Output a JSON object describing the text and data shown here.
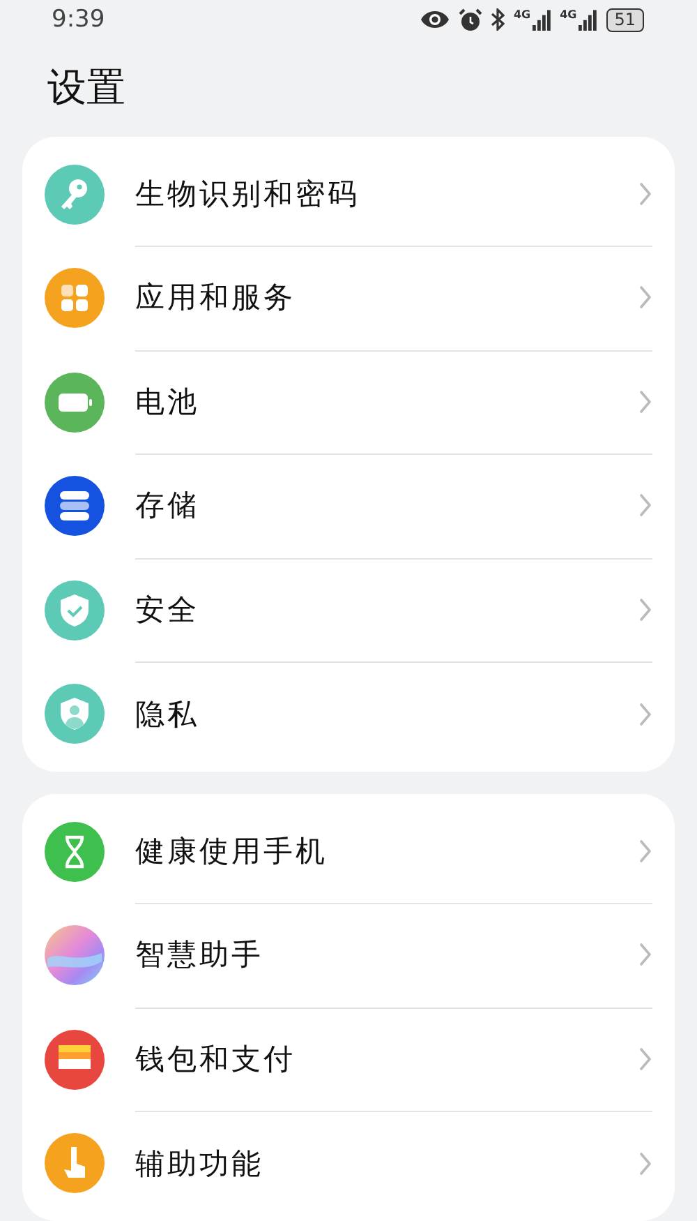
{
  "status_bar": {
    "time": "9:39",
    "networks": [
      "4G",
      "4G"
    ],
    "battery": "51"
  },
  "title": "设置",
  "groups": [
    {
      "items": [
        {
          "label": "生物识别和密码"
        },
        {
          "label": "应用和服务"
        },
        {
          "label": "电池"
        },
        {
          "label": "存储"
        },
        {
          "label": "安全"
        },
        {
          "label": "隐私"
        }
      ]
    },
    {
      "items": [
        {
          "label": "健康使用手机"
        },
        {
          "label": "智慧助手"
        },
        {
          "label": "钱包和支付"
        },
        {
          "label": "辅助功能"
        }
      ]
    }
  ]
}
